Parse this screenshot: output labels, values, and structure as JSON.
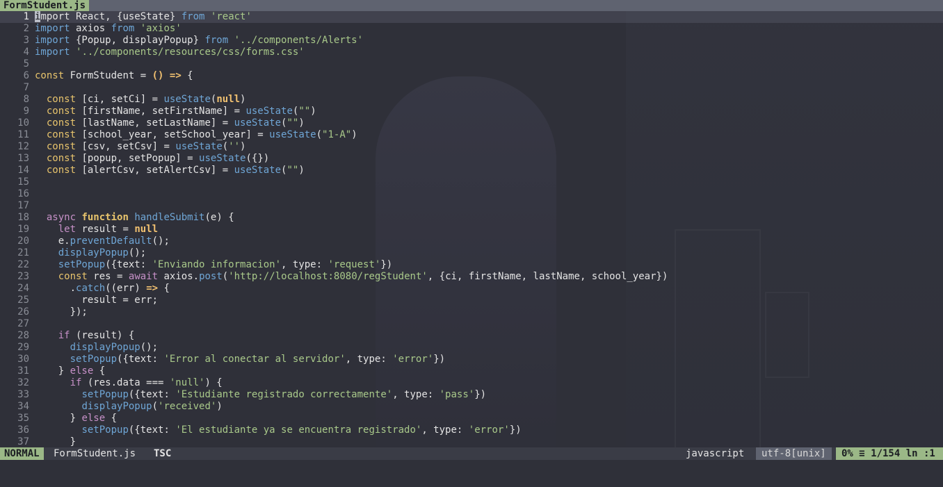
{
  "tab": {
    "title": "FormStudent.js"
  },
  "editor": {
    "current_line": 1,
    "lines": [
      {
        "n": "1",
        "html": "<span class=\"cursor\">i</span><span class=\"kw\" style=\"font-weight:normal;color:#e4e4e4\">mport</span> React, {useState} <span class=\"imp\">from</span> <span class=\"str\">'react'</span>"
      },
      {
        "n": "2",
        "html": "<span class=\"imp\" style=\"color:#6fa6d6\">import</span> axios <span class=\"imp\">from</span> <span class=\"str\">'axios'</span>"
      },
      {
        "n": "3",
        "html": "<span class=\"imp\">import</span> {Popup, displayPopup} <span class=\"imp\">from</span> <span class=\"str\">'../components/Alerts'</span>"
      },
      {
        "n": "4",
        "html": "<span class=\"imp\">import</span> <span class=\"str\">'../components/resources/css/forms.css'</span>"
      },
      {
        "n": "5",
        "html": ""
      },
      {
        "n": "6",
        "html": "<span class=\"kw\" style=\"font-weight:normal\">const</span> FormStudent = <span class=\"ar\">()</span> <span class=\"ar\">=&gt;</span> {"
      },
      {
        "n": "7",
        "html": ""
      },
      {
        "n": "8",
        "html": "  <span class=\"kw\" style=\"font-weight:normal\">const</span> [ci, setCi] = <span class=\"fn\">useState</span>(<span class=\"nul\">null</span>)"
      },
      {
        "n": "9",
        "html": "  <span class=\"kw\" style=\"font-weight:normal\">const</span> [firstName, setFirstName] = <span class=\"fn\">useState</span>(<span class=\"str\">\"\"</span>)"
      },
      {
        "n": "10",
        "html": "  <span class=\"kw\" style=\"font-weight:normal\">const</span> [lastName, setLastName] = <span class=\"fn\">useState</span>(<span class=\"str\">\"\"</span>)"
      },
      {
        "n": "11",
        "html": "  <span class=\"kw\" style=\"font-weight:normal\">const</span> [school_year, setSchool_year] = <span class=\"fn\">useState</span>(<span class=\"str\">\"1-A\"</span>)"
      },
      {
        "n": "12",
        "html": "  <span class=\"kw\" style=\"font-weight:normal\">const</span> [csv, setCsv] = <span class=\"fn\">useState</span>(<span class=\"str\">''</span>)"
      },
      {
        "n": "13",
        "html": "  <span class=\"kw\" style=\"font-weight:normal\">const</span> [popup, setPopup] = <span class=\"fn\">useState</span>({})"
      },
      {
        "n": "14",
        "html": "  <span class=\"kw\" style=\"font-weight:normal\">const</span> [alertCsv, setAlertCsv] = <span class=\"fn\">useState</span>(<span class=\"str\">\"\"</span>)"
      },
      {
        "n": "15",
        "html": ""
      },
      {
        "n": "16",
        "html": ""
      },
      {
        "n": "17",
        "html": ""
      },
      {
        "n": "18",
        "html": "  <span class=\"kwp\">async</span> <span class=\"kw\">function</span> <span class=\"fn\">handleSubmit</span>(e) {"
      },
      {
        "n": "19",
        "html": "    <span class=\"kwp\">let</span> result = <span class=\"nul\">null</span>"
      },
      {
        "n": "20",
        "html": "    e.<span class=\"fn\">preventDefault</span>();"
      },
      {
        "n": "21",
        "html": "    <span class=\"fn\">displayPopup</span>();"
      },
      {
        "n": "22",
        "html": "    <span class=\"fn\">setPopup</span>({text: <span class=\"str\">'Enviando informacion'</span>, type: <span class=\"str\">'request'</span>})"
      },
      {
        "n": "23",
        "html": "    <span class=\"kw\" style=\"font-weight:normal\">const</span> res = <span class=\"kwp\">await</span> axios.<span class=\"fn\">post</span>(<span class=\"str\">'http://localhost:8080/regStudent'</span>, {ci, firstName, lastName, school_year})"
      },
      {
        "n": "24",
        "html": "      .<span class=\"fn\">catch</span>((err) <span class=\"ar\">=&gt;</span> {"
      },
      {
        "n": "25",
        "html": "        result = err;"
      },
      {
        "n": "26",
        "html": "      });"
      },
      {
        "n": "27",
        "html": ""
      },
      {
        "n": "28",
        "html": "    <span class=\"kwp\">if</span> (result) {"
      },
      {
        "n": "29",
        "html": "      <span class=\"fn\">displayPopup</span>();"
      },
      {
        "n": "30",
        "html": "      <span class=\"fn\">setPopup</span>({text: <span class=\"str\">'Error al conectar al servidor'</span>, type: <span class=\"str\">'error'</span>})"
      },
      {
        "n": "31",
        "html": "    } <span class=\"kwp\">else</span> {"
      },
      {
        "n": "32",
        "html": "      <span class=\"kwp\">if</span> (res.data === <span class=\"str\">'null'</span>) {"
      },
      {
        "n": "33",
        "html": "        <span class=\"fn\">setPopup</span>({text: <span class=\"str\">'Estudiante registrado correctamente'</span>, type: <span class=\"str\">'pass'</span>})"
      },
      {
        "n": "34",
        "html": "        <span class=\"fn\">displayPopup</span>(<span class=\"str\">'received'</span>)"
      },
      {
        "n": "35",
        "html": "      } <span class=\"kwp\">else</span> {"
      },
      {
        "n": "36",
        "html": "        <span class=\"fn\">setPopup</span>({text: <span class=\"str\">'El estudiante ya se encuentra registrado'</span>, type: <span class=\"str\">'error'</span>})"
      },
      {
        "n": "37",
        "html": "      }"
      }
    ]
  },
  "statusline": {
    "mode": "NORMAL",
    "filename": "FormStudent.js",
    "tag": "TSC",
    "filetype": "javascript",
    "encoding": "utf-8[unix]",
    "position": "0% ≡ 1/154 ln :1"
  },
  "colors": {
    "accent": "#9bb887",
    "background": "#2f3039"
  }
}
